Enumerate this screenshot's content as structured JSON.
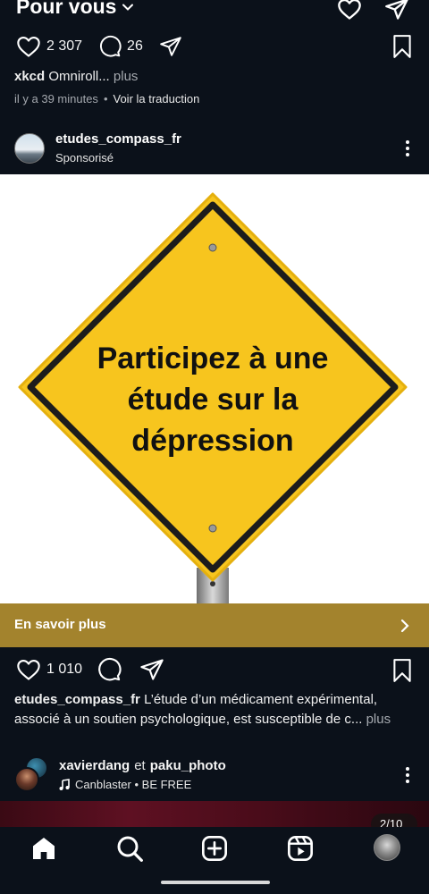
{
  "header": {
    "title": "Pour vous",
    "icons": [
      "chevron-down-icon",
      "heart-icon",
      "send-icon"
    ]
  },
  "post1": {
    "likes": "2 307",
    "comments": "26",
    "caption_user": "xkcd",
    "caption_text": "Omniroll...",
    "more": "plus",
    "time": "il y a 39 minutes",
    "separator": "•",
    "translate": "Voir la traduction"
  },
  "ad": {
    "username": "etudes_compass_fr",
    "sponsored": "Sponsorisé",
    "sign_lines": [
      "Participez à une",
      "étude sur la",
      "dépression"
    ],
    "cta": "En savoir plus",
    "likes": "1 010",
    "caption_user": "etudes_compass_fr",
    "caption_line1": "L’étude d’un médicament expérimental,",
    "caption_line2": "associé à un soutien psychologique, est susceptible de c...",
    "more": "plus",
    "colors": {
      "sign": "#f7c51e",
      "cta": "#a3832d"
    }
  },
  "post3": {
    "user1": "xavierdang",
    "and": "et",
    "user2": "paku_photo",
    "music": "Canblaster • BE FREE",
    "counter": "2/10"
  },
  "nav": {
    "items": [
      "home-icon",
      "search-icon",
      "create-icon",
      "reels-icon",
      "profile-avatar"
    ]
  }
}
